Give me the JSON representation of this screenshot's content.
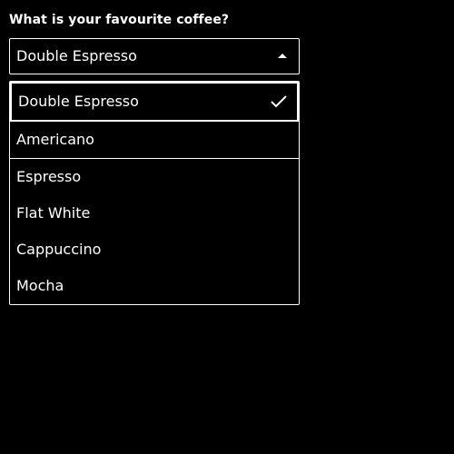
{
  "form": {
    "question": "What is your favourite coffee?"
  },
  "select": {
    "value": "Double Espresso",
    "expanded": true
  },
  "options": [
    {
      "label": "Double Espresso",
      "selected": true
    },
    {
      "label": "Americano",
      "selected": false
    },
    {
      "label": "Espresso",
      "selected": false
    },
    {
      "label": "Flat White",
      "selected": false
    },
    {
      "label": "Cappuccino",
      "selected": false
    },
    {
      "label": "Mocha",
      "selected": false
    }
  ],
  "icons": {
    "caret": "caret-up-icon",
    "check": "check-icon"
  },
  "colors": {
    "background": "#000000",
    "foreground": "#ffffff"
  }
}
